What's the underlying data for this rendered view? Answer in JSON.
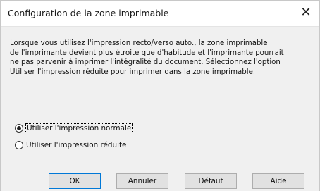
{
  "dialog": {
    "title": "Configuration de la zone imprimable",
    "close_label": "✕",
    "message": "Lorsque vous utilisez l'impression recto/verso auto., la zone imprimable\nde l'imprimante devient plus étroite que d'habitude et l'imprimante pourrait\nne pas parvenir à imprimer l'intégralité du document. Sélectionnez l'option\nUtiliser l'impression réduite pour imprimer dans la zone imprimable.",
    "options": [
      {
        "label": "Utiliser l'impression normale",
        "checked": true
      },
      {
        "label": "Utiliser l'impression réduite",
        "checked": false
      }
    ],
    "buttons": {
      "ok": "OK",
      "cancel": "Annuler",
      "default": "Défaut",
      "help": "Aide"
    }
  }
}
